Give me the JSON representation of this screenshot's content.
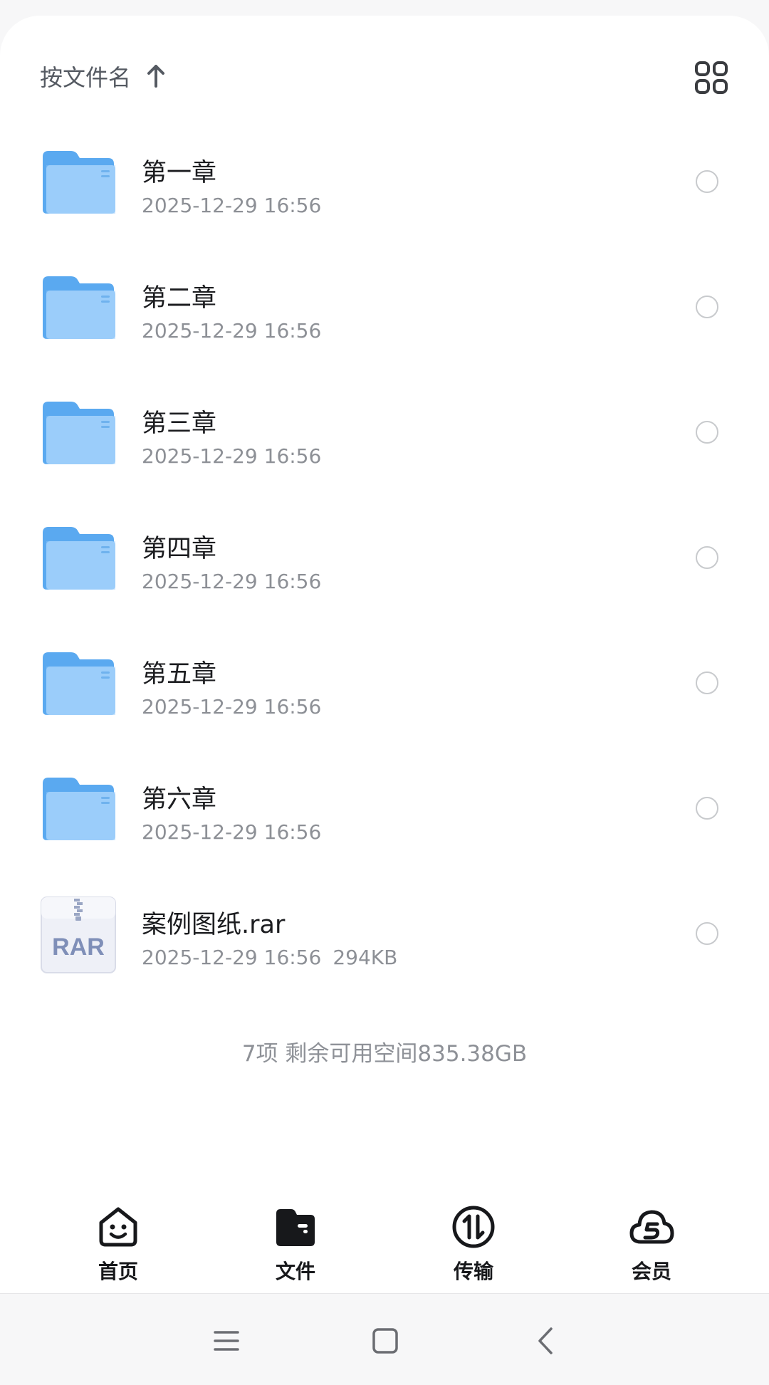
{
  "sort_bar": {
    "label": "按文件名",
    "direction_icon": "arrow-up-icon",
    "view_toggle_icon": "grid-view-icon"
  },
  "files": [
    {
      "name": "第一章",
      "date": "2025-12-29 16:56",
      "size": "",
      "type": "folder"
    },
    {
      "name": "第二章",
      "date": "2025-12-29 16:56",
      "size": "",
      "type": "folder"
    },
    {
      "name": "第三章",
      "date": "2025-12-29 16:56",
      "size": "",
      "type": "folder"
    },
    {
      "name": "第四章",
      "date": "2025-12-29 16:56",
      "size": "",
      "type": "folder"
    },
    {
      "name": "第五章",
      "date": "2025-12-29 16:56",
      "size": "",
      "type": "folder"
    },
    {
      "name": "第六章",
      "date": "2025-12-29 16:56",
      "size": "",
      "type": "folder"
    },
    {
      "name": "案例图纸.rar",
      "date": "2025-12-29 16:56",
      "size": "294KB",
      "type": "rar",
      "badge": "RAR"
    }
  ],
  "footer_info": "7项 剩余可用空间835.38GB",
  "tabs": [
    {
      "label": "首页",
      "icon": "smiley-home-icon"
    },
    {
      "label": "文件",
      "icon": "folder-filled-icon"
    },
    {
      "label": "传输",
      "icon": "transfer-arrows-icon"
    },
    {
      "label": "会员",
      "icon": "cloud-s-icon"
    }
  ],
  "colors": {
    "folder_dark": "#5aa9f0",
    "folder_light": "#a6d3fb",
    "text_primary": "#1c1d20",
    "text_secondary": "#8d9096"
  }
}
